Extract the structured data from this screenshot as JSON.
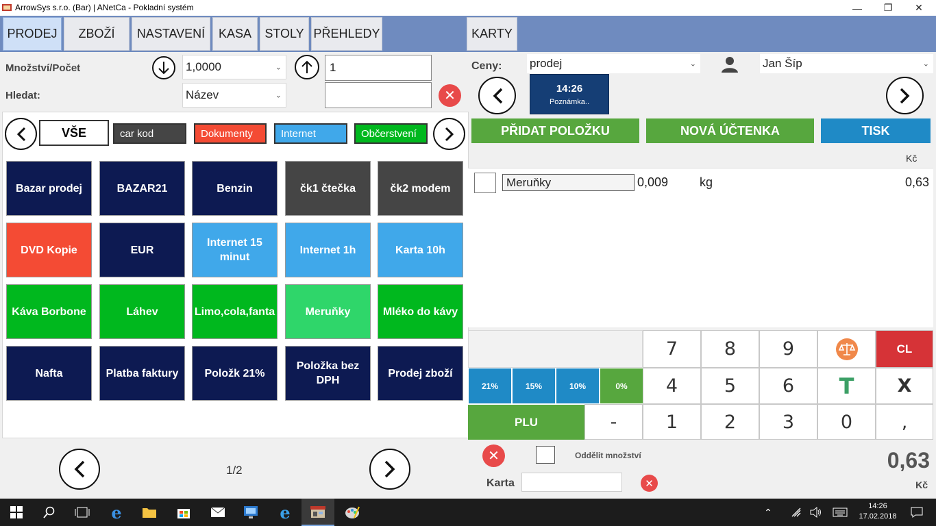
{
  "window": {
    "title": "ArrowSys s.r.o. (Bar) | ANetCa - Pokladní systém",
    "controls": [
      "—",
      "❐",
      "✕"
    ]
  },
  "nav": {
    "tabs": [
      "PRODEJ",
      "ZBOŽÍ",
      "NASTAVENÍ",
      "KASA",
      "STOLY",
      "PŘEHLEDY"
    ],
    "karty": "KARTY"
  },
  "left": {
    "qty_label": "Množství/Počet",
    "qty_value": "1,0000",
    "count_value": "1",
    "search_label": "Hledat:",
    "search_by": "Název",
    "search_text": "",
    "categories": [
      {
        "label": "VŠE",
        "bg": "#ffffff",
        "fg": "#000000"
      },
      {
        "label": "car kod",
        "bg": "#454545",
        "fg": "#ffffff"
      },
      {
        "label": "Dokumenty",
        "bg": "#f44b34",
        "fg": "#ffffff"
      },
      {
        "label": "Internet",
        "bg": "#40a8ea",
        "fg": "#ffffff"
      },
      {
        "label": "Občerstvení",
        "bg": "#00b81e",
        "fg": "#ffffff"
      }
    ],
    "products": [
      {
        "label": "Bazar prodej",
        "color": "navy"
      },
      {
        "label": "BAZAR21",
        "color": "navy"
      },
      {
        "label": "Benzin",
        "color": "navy"
      },
      {
        "label": "čk1 čtečka",
        "color": "grey"
      },
      {
        "label": "čk2 modem",
        "color": "grey"
      },
      {
        "label": "DVD Kopie",
        "color": "red"
      },
      {
        "label": "EUR",
        "color": "navy"
      },
      {
        "label": "Internet 15 minut",
        "color": "blue"
      },
      {
        "label": "Internet 1h",
        "color": "blue"
      },
      {
        "label": "Karta 10h",
        "color": "blue"
      },
      {
        "label": "Káva Borbone",
        "color": "green"
      },
      {
        "label": "Láhev",
        "color": "green"
      },
      {
        "label": "Limo,cola,fanta",
        "color": "green"
      },
      {
        "label": "Meruňky",
        "color": "lgreen"
      },
      {
        "label": "Mléko do kávy",
        "color": "green"
      },
      {
        "label": "Nafta",
        "color": "navy"
      },
      {
        "label": "Platba faktury",
        "color": "navy"
      },
      {
        "label": "Položk 21%",
        "color": "navy"
      },
      {
        "label": "Položka bez DPH",
        "color": "navy"
      },
      {
        "label": "Prodej zboží",
        "color": "navy"
      }
    ],
    "page_indicator": "1/2"
  },
  "right": {
    "price_label": "Ceny:",
    "price_list": "prodej",
    "user": "Jan  Šíp",
    "note_time": "14:26",
    "note_label": "Poznámka..",
    "add_item": "PŘIDAT POLOŽKU",
    "new_receipt": "NOVÁ ÚČTENKA",
    "print": "TISK",
    "currency_header": "Kč",
    "items": [
      {
        "name": "Meruňky",
        "qty": "0,009",
        "unit": "kg",
        "price": "0,63"
      }
    ],
    "keypad": {
      "vat": [
        "21%",
        "15%",
        "10%",
        "0%"
      ],
      "plu": "PLU",
      "keys": [
        "7",
        "8",
        "9",
        "4",
        "5",
        "6",
        "1",
        "2",
        "3",
        "-",
        "0",
        ","
      ],
      "cl": "CL",
      "t": "T",
      "x": "X"
    },
    "split_qty_label": "Oddělit množství",
    "card_label": "Karta",
    "card_value": "",
    "total": "0,63",
    "total_currency": "Kč"
  },
  "taskbar": {
    "time": "14:26",
    "date": "17.02.2018"
  }
}
